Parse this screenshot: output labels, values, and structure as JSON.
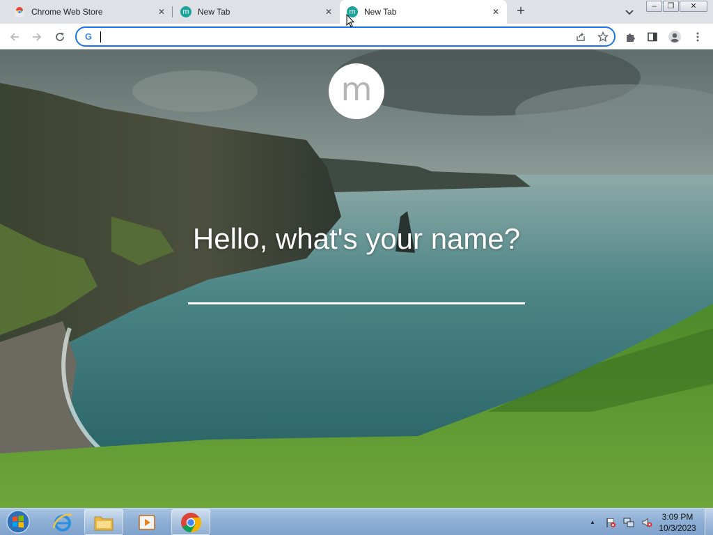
{
  "tabs": [
    {
      "title": "Chrome Web Store",
      "favicon": "chrome-web-store-icon",
      "active": false
    },
    {
      "title": "New Tab",
      "favicon": "momentum-icon",
      "favicon_letter": "m",
      "active": false
    },
    {
      "title": "New Tab",
      "favicon": "momentum-icon",
      "favicon_letter": "m",
      "active": true
    }
  ],
  "tab_close_glyph": "✕",
  "new_tab_glyph": "+",
  "window_controls": {
    "minimize": "–",
    "restore": "❐",
    "close": "✕"
  },
  "omnibox": {
    "value": "",
    "logo_letter": "G"
  },
  "page": {
    "logo_letter": "m",
    "greeting": "Hello, what's your name?",
    "name_value": ""
  },
  "taskbar": {
    "items": [
      "start-orb",
      "internet-explorer",
      "file-explorer",
      "media-player",
      "google-chrome"
    ],
    "clock_time": "3:09 PM",
    "clock_date": "10/3/2023",
    "tray_expand_glyph": "▲"
  },
  "colors": {
    "accent": "#1a73e8",
    "tabstrip": "#dee1e6",
    "momentum": "#1aa39a",
    "taskbar": "#8fb0d6"
  }
}
